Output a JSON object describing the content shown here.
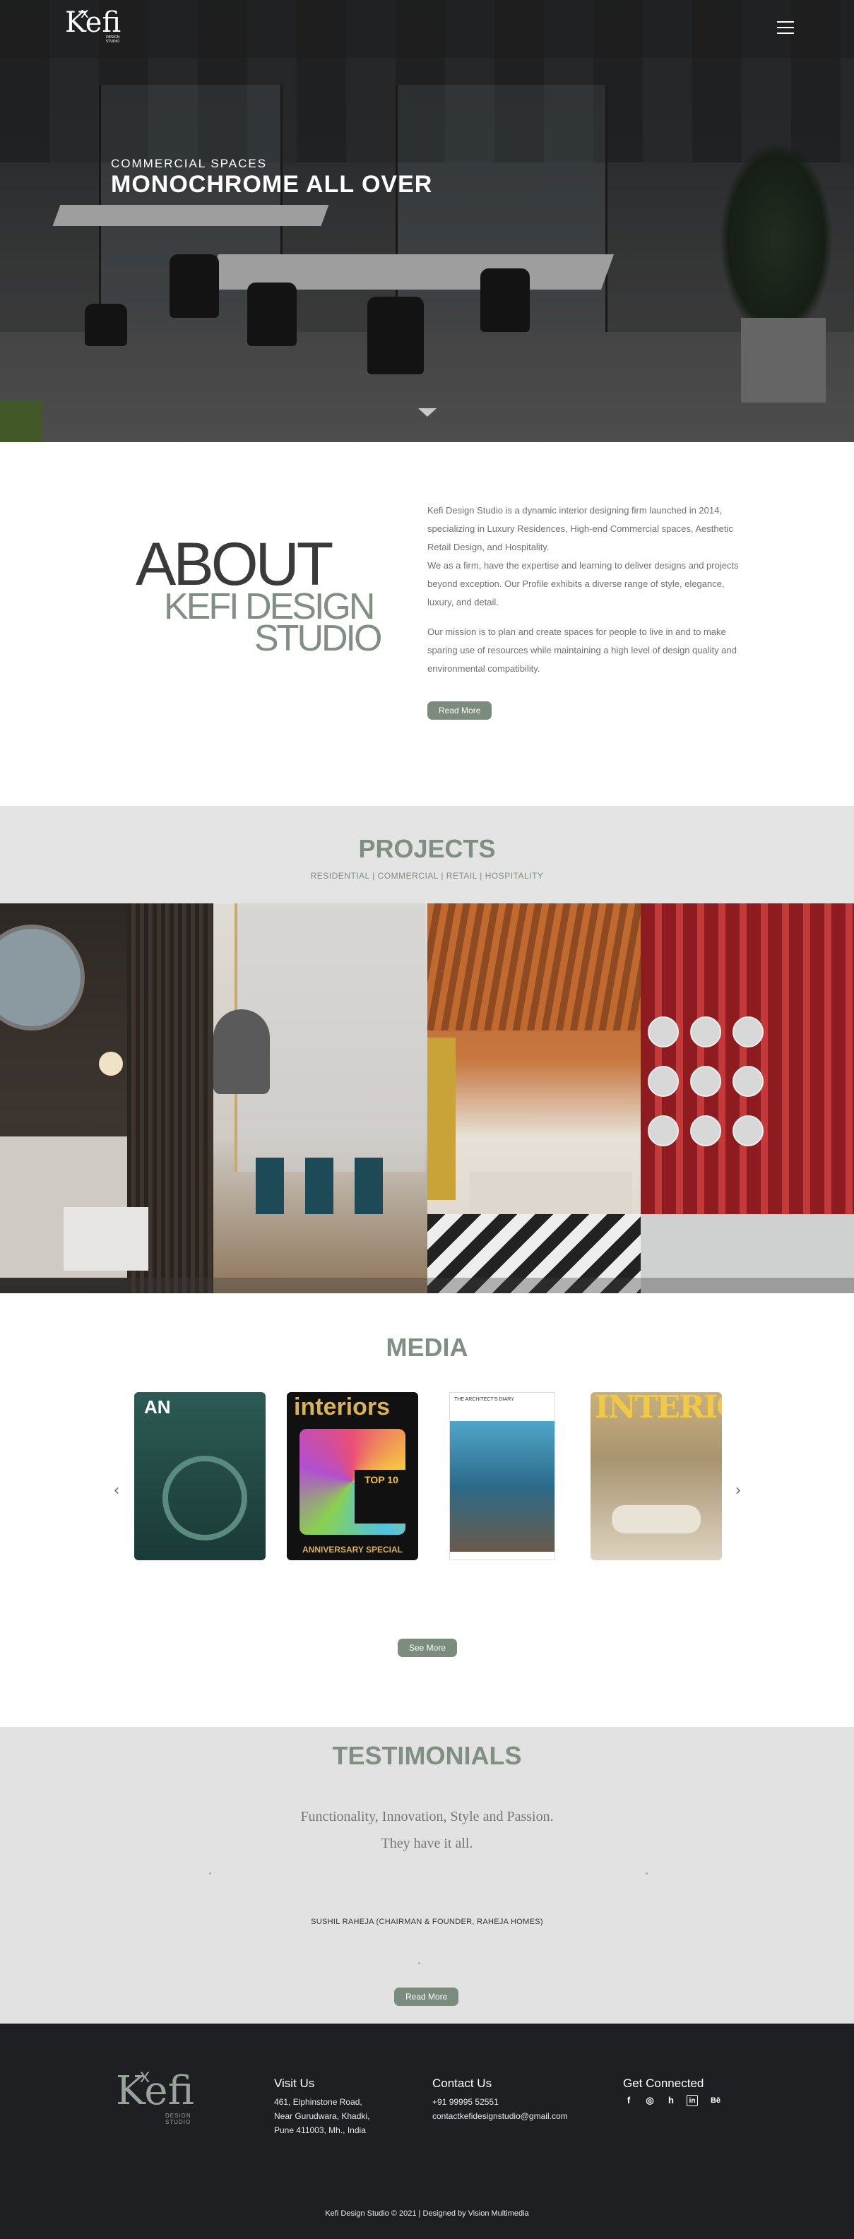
{
  "header": {
    "logo_text": "Kefi",
    "logo_sub": "DESIGN STUDIO",
    "menu_icon": "hamburger-icon"
  },
  "hero": {
    "subtitle": "COMMERCIAL SPACES",
    "title": "MONOCHROME ALL OVER",
    "scroll_icon": "chevron-down-icon"
  },
  "about": {
    "graphic_line1": "ABOUT",
    "graphic_line2": "KEFI DESIGN",
    "graphic_line3": "STUDIO",
    "paragraph1": "Kefi Design Studio is a dynamic interior designing firm launched in 2014, specializing in Luxury Residences, High-end Commercial spaces, Aesthetic Retail Design, and Hospitality.",
    "paragraph2": "We as a firm, have the expertise and learning to deliver designs and projects beyond exception. Our Profile exhibits a diverse range of style, elegance, luxury, and detail.",
    "paragraph3": "Our mission is to plan and create spaces for people to live in and to make sparing use of resources while maintaining a high level of design quality and environmental compatibility.",
    "button": "Read More"
  },
  "projects": {
    "title": "PROJECTS",
    "subtitle": "RESIDENTIAL | COMMERCIAL | RETAIL | HOSPITALITY"
  },
  "media": {
    "title": "MEDIA",
    "prev_icon": "chevron-left-icon",
    "next_icon": "chevron-right-icon",
    "magazines": [
      {
        "masthead": "AN"
      },
      {
        "masthead": "interiors",
        "badge": "TOP 10",
        "footer": "ANNIVERSARY SPECIAL"
      },
      {
        "masthead": "THE ARCHITECT'S DIARY"
      },
      {
        "masthead": "INTERIORS"
      }
    ],
    "button": "See More"
  },
  "testimonials": {
    "title": "TESTIMONIALS",
    "quote_line1": "Functionality, Innovation, Style and Passion.",
    "quote_line2": "They have it all.",
    "author": "SUSHIL RAHEJA (CHAIRMAN & FOUNDER, RAHEJA HOMES)",
    "button": "Read More"
  },
  "footer": {
    "logo_text": "Kefi",
    "logo_sub": "DESIGN STUDIO",
    "visit": {
      "heading": "Visit Us",
      "lines": [
        "461, Elphinstone Road,",
        "Near Gurudwara, Khadki,",
        "Pune 411003, Mh., India"
      ]
    },
    "contact": {
      "heading": "Contact Us",
      "phone": "+91 99995 52551",
      "email": "contactkefidesignstudio@gmail.com"
    },
    "social": {
      "heading": "Get Connected",
      "icons": [
        "facebook-icon",
        "instagram-icon",
        "houzz-icon",
        "linkedin-icon",
        "behance-icon"
      ],
      "glyphs": [
        "f",
        "◎",
        "h",
        "in",
        "Bē"
      ]
    },
    "copyright": "Kefi Design Studio © 2021 | Designed by Vision Multimedia"
  },
  "colors": {
    "accent": "#7b8b7d",
    "heading_green": "#7f8f82",
    "footer_bg": "#1d1f22",
    "section_grey": "#e4e4e4"
  }
}
